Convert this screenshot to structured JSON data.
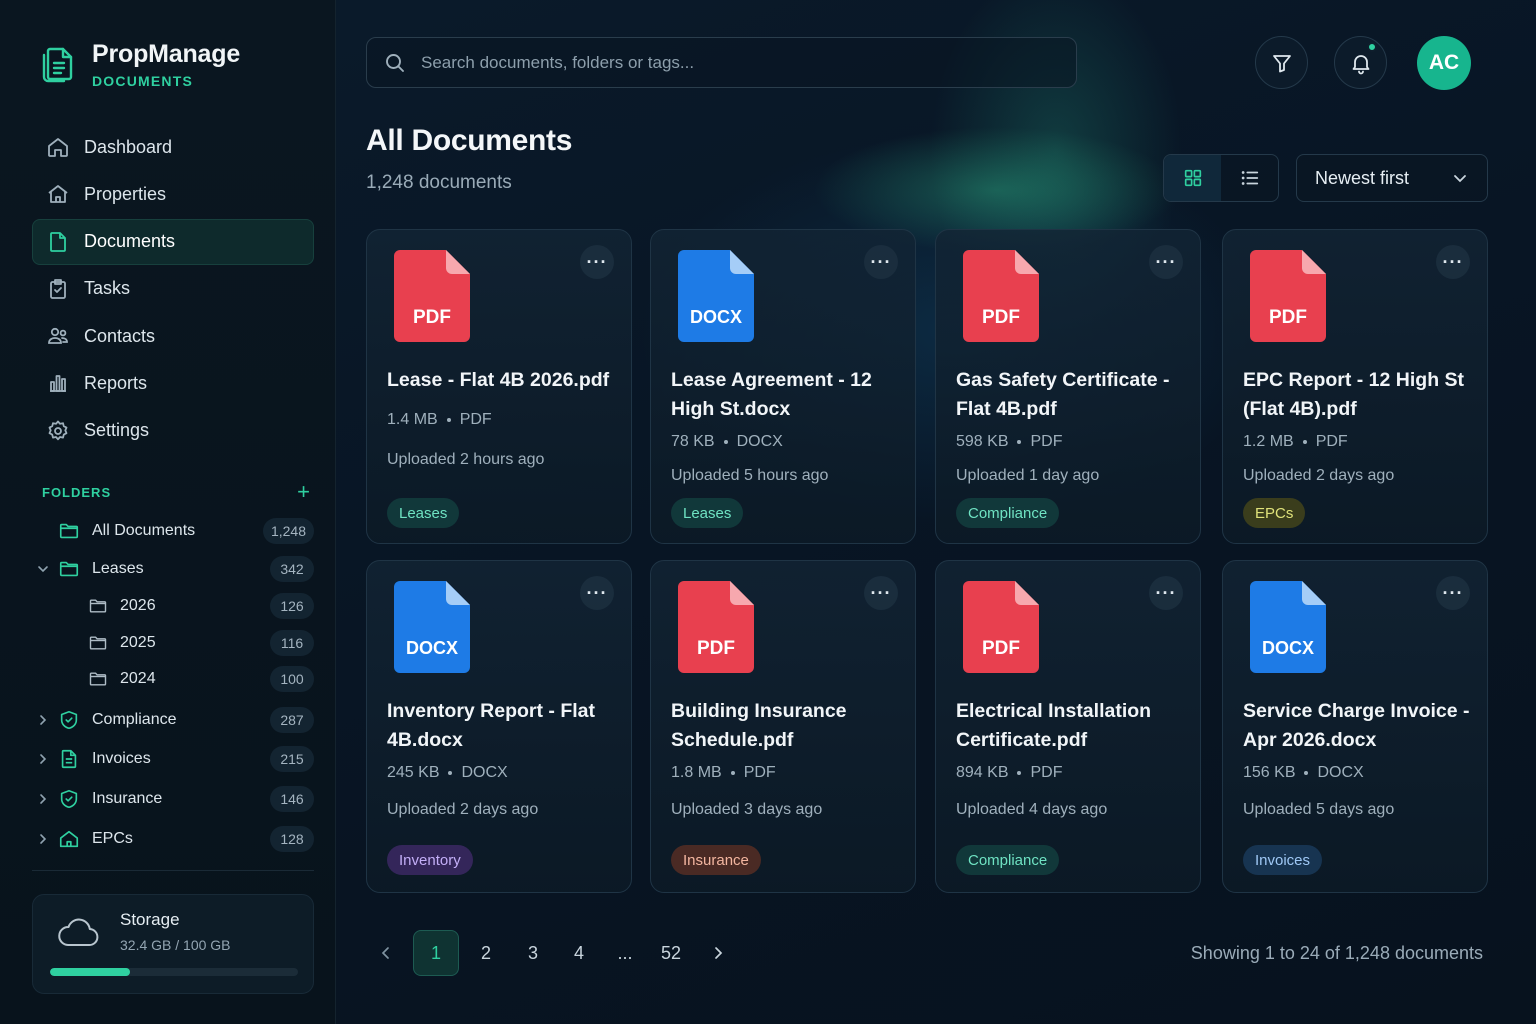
{
  "brand": {
    "name": "PropManage",
    "sub": "DOCUMENTS"
  },
  "nav": [
    {
      "label": "Dashboard",
      "icon": "home-icon",
      "active": false
    },
    {
      "label": "Properties",
      "icon": "building-icon",
      "active": false
    },
    {
      "label": "Documents",
      "icon": "document-icon",
      "active": true
    },
    {
      "label": "Tasks",
      "icon": "clipboard-check-icon",
      "active": false
    },
    {
      "label": "Contacts",
      "icon": "users-icon",
      "active": false
    },
    {
      "label": "Reports",
      "icon": "bar-chart-icon",
      "active": false
    },
    {
      "label": "Settings",
      "icon": "gear-icon",
      "active": false
    }
  ],
  "folders": {
    "title": "FOLDERS",
    "add": "+",
    "items": [
      {
        "name": "All Documents",
        "count": "1,248"
      },
      {
        "name": "Leases",
        "count": "342",
        "expanded": true,
        "children": [
          {
            "name": "2026",
            "count": "126"
          },
          {
            "name": "2025",
            "count": "116"
          },
          {
            "name": "2024",
            "count": "100"
          }
        ]
      },
      {
        "name": "Compliance",
        "count": "287",
        "icon": "shield-icon"
      },
      {
        "name": "Invoices",
        "count": "215",
        "icon": "invoice-icon"
      },
      {
        "name": "Insurance",
        "count": "146",
        "icon": "shield-icon"
      },
      {
        "name": "EPCs",
        "count": "128",
        "icon": "house-icon"
      }
    ]
  },
  "storage": {
    "title": "Storage",
    "size": "32.4 GB / 100 GB",
    "used_fraction": 0.324
  },
  "search": {
    "placeholder": "Search documents, folders or tags..."
  },
  "header": {
    "avatar": "AC"
  },
  "page": {
    "title": "All Documents",
    "subtitle": "1,248 documents"
  },
  "sort": {
    "label": "Newest first"
  },
  "colors": {
    "accent": "#2fd0a0",
    "pdf": "#e8404f",
    "docx": "#1e7be6"
  },
  "documents": [
    {
      "type": "PDF",
      "title": "Lease - Flat 4B 2026.pdf",
      "size": "1.4 MB",
      "ext": "PDF",
      "uploaded": "Uploaded 2 hours ago",
      "tag": "Leases"
    },
    {
      "type": "DOCX",
      "title": "Lease Agreement - 12 High St.docx",
      "size": "78 KB",
      "ext": "DOCX",
      "uploaded": "Uploaded 5 hours ago",
      "tag": "Leases"
    },
    {
      "type": "PDF",
      "title": "Gas Safety Certificate - Flat 4B.pdf",
      "size": "598 KB",
      "ext": "PDF",
      "uploaded": "Uploaded 1 day ago",
      "tag": "Compliance"
    },
    {
      "type": "PDF",
      "title": "EPC Report - 12 High St (Flat 4B).pdf",
      "size": "1.2 MB",
      "ext": "PDF",
      "uploaded": "Uploaded 2 days ago",
      "tag": "EPCs"
    },
    {
      "type": "DOCX",
      "title": "Inventory Report - Flat 4B.docx",
      "size": "245 KB",
      "ext": "DOCX",
      "uploaded": "Uploaded 2 days ago",
      "tag": "Inventory"
    },
    {
      "type": "PDF",
      "title": "Building Insurance Schedule.pdf",
      "size": "1.8 MB",
      "ext": "PDF",
      "uploaded": "Uploaded 3 days ago",
      "tag": "Insurance"
    },
    {
      "type": "PDF",
      "title": "Electrical Installation Certificate.pdf",
      "size": "894 KB",
      "ext": "PDF",
      "uploaded": "Uploaded 4 days ago",
      "tag": "Compliance"
    },
    {
      "type": "DOCX",
      "title": "Service Charge Invoice - Apr 2026.docx",
      "size": "156 KB",
      "ext": "DOCX",
      "uploaded": "Uploaded 5 days ago",
      "tag": "Invoices"
    }
  ],
  "pagination": {
    "pages": [
      "1",
      "2",
      "3",
      "4",
      "...",
      "52"
    ],
    "current": "1"
  },
  "showing": "Showing 1 to 24 of 1,248 documents"
}
